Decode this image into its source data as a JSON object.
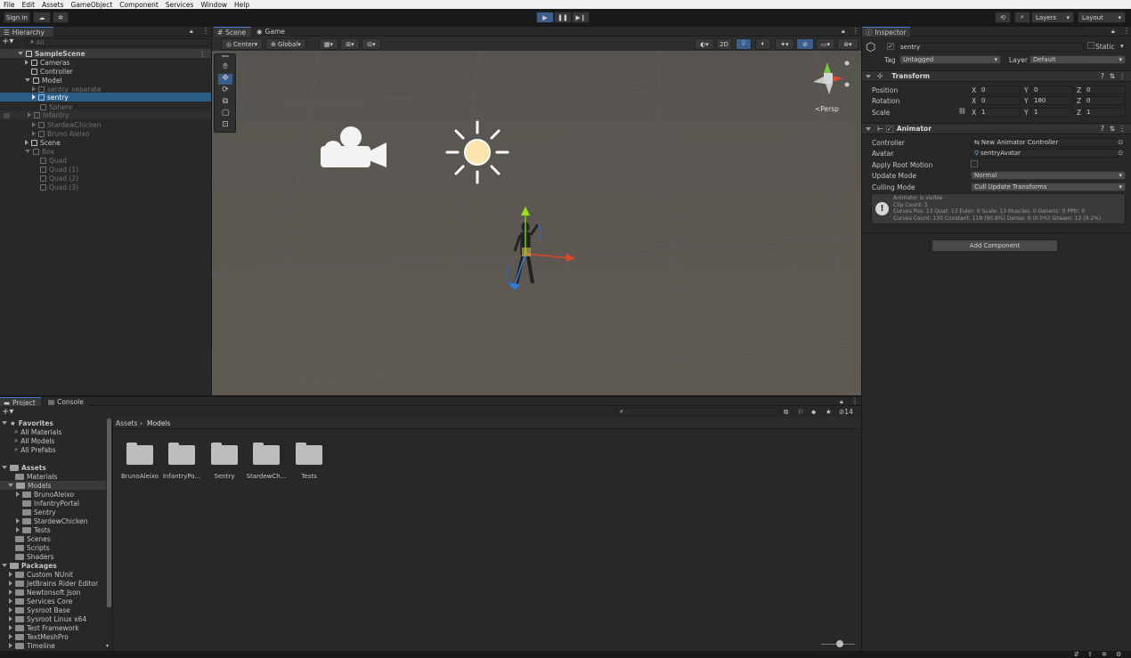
{
  "menu": [
    "File",
    "Edit",
    "Assets",
    "GameObject",
    "Component",
    "Services",
    "Window",
    "Help"
  ],
  "toolbar": {
    "sign_in": "Sign In",
    "layers": "Layers",
    "layout": "Layout"
  },
  "hierarchy": {
    "tab": "Hierarchy",
    "search_placeholder": "All",
    "items": [
      {
        "label": "SampleScene"
      },
      {
        "label": "Cameras"
      },
      {
        "label": "Controller"
      },
      {
        "label": "Model"
      },
      {
        "label": "sentry_separate"
      },
      {
        "label": "sentry"
      },
      {
        "label": "Sphere"
      },
      {
        "label": "Infantry"
      },
      {
        "label": "StardewChicken"
      },
      {
        "label": "Bruno Aleixo"
      },
      {
        "label": "Scene"
      },
      {
        "label": "Box"
      },
      {
        "label": "Quad"
      },
      {
        "label": "Quad (1)"
      },
      {
        "label": "Quad (2)"
      },
      {
        "label": "Quad (3)"
      }
    ]
  },
  "scene": {
    "tabs": [
      "Scene",
      "Game"
    ],
    "pivot": "Center",
    "space": "Global",
    "mode_2d": "2D",
    "persp": "<Persp"
  },
  "inspector": {
    "tab": "Inspector",
    "object_name": "sentry",
    "static": "Static",
    "tag_label": "Tag",
    "tag_value": "Untagged",
    "layer_label": "Layer",
    "layer_value": "Default",
    "transform": {
      "title": "Transform",
      "position": "Position",
      "rotation": "Rotation",
      "scale": "Scale",
      "x": "X",
      "y": "Y",
      "z": "Z",
      "pos": [
        "0",
        "0",
        "0"
      ],
      "rot": [
        "0",
        "180",
        "0"
      ],
      "scl": [
        "1",
        "1",
        "1"
      ]
    },
    "animator": {
      "title": "Animator",
      "controller_label": "Controller",
      "controller_value": "New Animator Controller",
      "avatar_label": "Avatar",
      "avatar_value": "sentryAvatar",
      "root_motion_label": "Apply Root Motion",
      "update_label": "Update Mode",
      "update_value": "Normal",
      "culling_label": "Culling Mode",
      "culling_value": "Cull Update Transforms",
      "info_lines": [
        "Animator is visible",
        "Clip Count: 1",
        "Curves Pos: 13 Quat: 13 Euler: 0 Scale: 13 Muscles: 0 Generic: 0 PPtr: 0",
        "Curves Count: 130 Constant: 118 (90.8%) Dense: 0 (0.0%) Stream: 12 (9.2%)"
      ]
    },
    "add_component": "Add Component"
  },
  "project": {
    "tabs": [
      "Project",
      "Console"
    ],
    "count": "14",
    "breadcrumb": [
      "Assets",
      "Models"
    ],
    "tree": {
      "favorites": "Favorites",
      "fav_items": [
        "All Materials",
        "All Models",
        "All Prefabs"
      ],
      "assets": "Assets",
      "asset_items": [
        "Materials",
        "Models"
      ],
      "model_items": [
        "BrunoAleixo",
        "InfantryPortal",
        "Sentry",
        "StardewChicken",
        "Tests"
      ],
      "asset_items2": [
        "Scenes",
        "Scripts",
        "Shaders"
      ],
      "packages": "Packages",
      "package_items": [
        "Custom NUnit",
        "JetBrains Rider Editor",
        "Newtonsoft Json",
        "Services Core",
        "Sysroot Base",
        "Sysroot Linux x64",
        "Test Framework",
        "TextMeshPro",
        "Timeline"
      ]
    },
    "folders": [
      "BrunoAleixo",
      "InfantryPo...",
      "Sentry",
      "StardewCh...",
      "Tests"
    ]
  },
  "colors": {
    "accent": "#3d7ad0",
    "selection": "#2c5d87",
    "scene_bg": "#5a5550"
  }
}
